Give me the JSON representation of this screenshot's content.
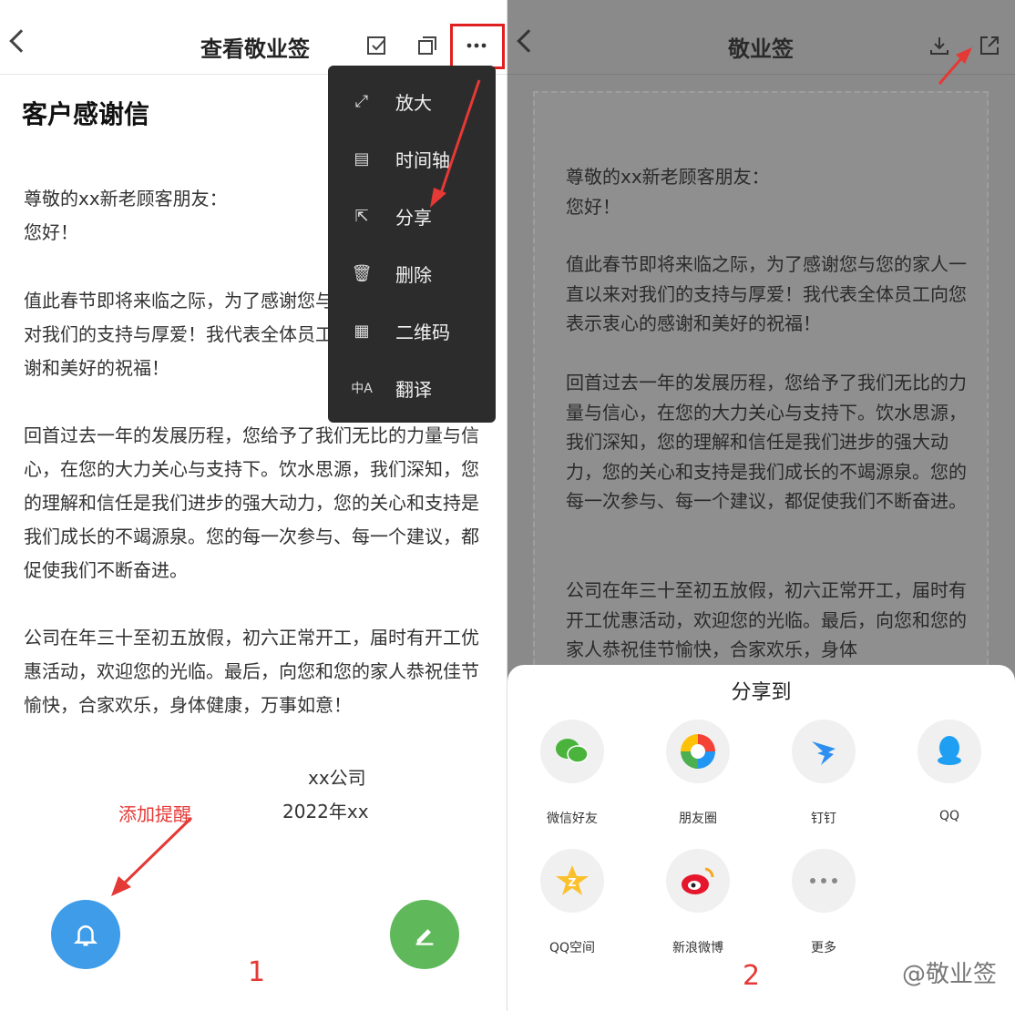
{
  "panel1": {
    "title": "查看敬业签",
    "doc_title": "客户感谢信",
    "p1": "尊敬的xx新老顾客朋友：\n您好！",
    "p2": "值此春节即将来临之际，为了感谢您与您的家人一直以来对我们的支持与厚爱！我代表全体员工向您表示衷心的感谢和美好的祝福！",
    "p3": "回首过去一年的发展历程，您给予了我们无比的力量与信心，在您的大力关心与支持下。饮水思源，我们深知，您的理解和信任是我们进步的强大动力，您的关心和支持是我们成长的不竭源泉。您的每一次参与、每一个建议，都促使我们不断奋进。",
    "p4": "公司在年三十至初五放假，初六正常开工，届时有开工优惠活动，欢迎您的光临。最后，向您和您的家人恭祝佳节愉快，合家欢乐，身体健康，万事如意！",
    "sign1": "xx公司",
    "sign2": "2022年xx",
    "menu": [
      "放大",
      "时间轴",
      "分享",
      "删除",
      "二维码",
      "翻译"
    ],
    "annotation": "添加提醒",
    "step": "1"
  },
  "panel2": {
    "title": "敬业签",
    "p1": "尊敬的xx新老顾客朋友：\n您好！",
    "p2": "值此春节即将来临之际，为了感谢您与您的家人一直以来对我们的支持与厚爱！我代表全体员工向您表示衷心的感谢和美好的祝福！",
    "p3": "回首过去一年的发展历程，您给予了我们无比的力量与信心，在您的大力关心与支持下。饮水思源，我们深知，您的理解和信任是我们进步的强大动力，您的关心和支持是我们成长的不竭源泉。您的每一次参与、每一个建议，都促使我们不断奋进。",
    "p4": "公司在年三十至初五放假，初六正常开工，届时有开工优惠活动，欢迎您的光临。最后，向您和您的家人恭祝佳节愉快，合家欢乐，身体",
    "share_title": "分享到",
    "share": [
      "微信好友",
      "朋友圈",
      "钉钉",
      "QQ",
      "QQ空间",
      "新浪微博",
      "更多"
    ],
    "step": "2",
    "watermark": "@敬业签"
  },
  "colors": {
    "accent_red": "#e53935",
    "fab_blue": "#3f9ce8",
    "fab_green": "#5fb85a",
    "menu_bg": "#2c2c2c"
  }
}
